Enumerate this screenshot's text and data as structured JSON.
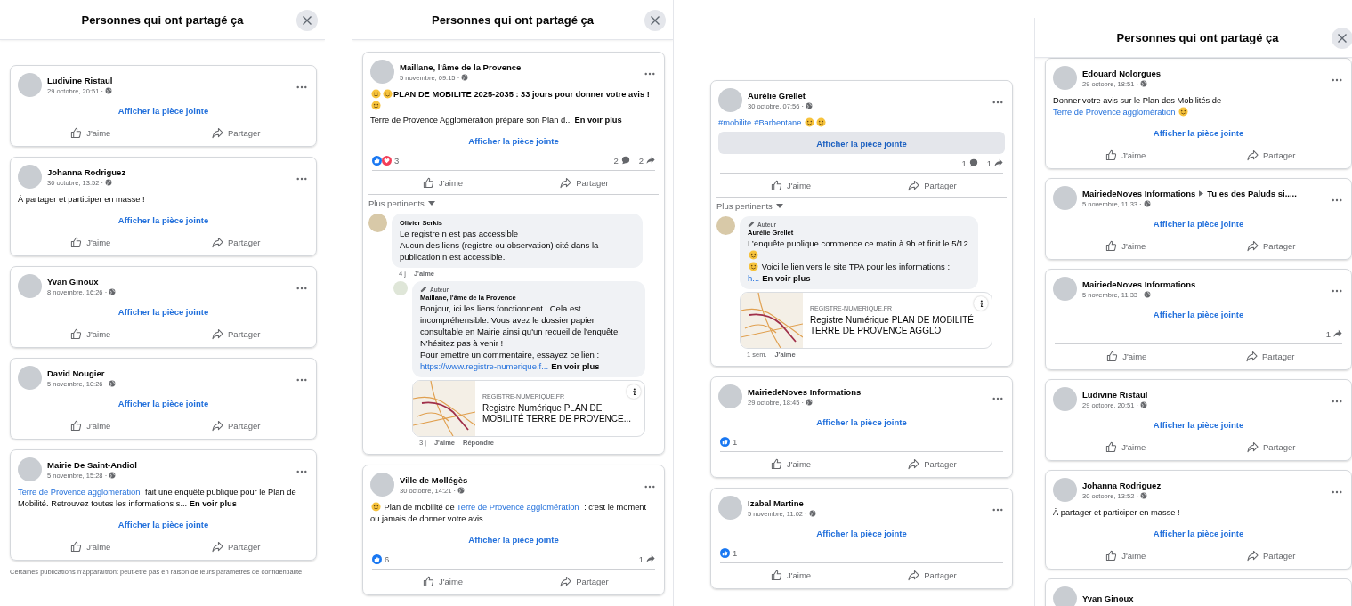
{
  "panels": [
    {
      "title": "Personnes qui ont partagé ça",
      "posts": [
        {
          "author": "Ludivine Ristaul",
          "date": "29 octobre, 20:51 ·",
          "attachment": {
            "label": "Afficher la pièce jointe",
            "highlighted": false
          },
          "actions": [
            {
              "kind": "like",
              "label": "J'aime"
            },
            {
              "kind": "share",
              "label": "Partager"
            }
          ]
        },
        {
          "author": "Johanna Rodriguez",
          "date": "30 octobre, 13:52 ·",
          "text": [
            [
              {
                "kind": "plain",
                "text": "À partager et participer en masse !"
              }
            ]
          ],
          "attachment": {
            "label": "Afficher la pièce jointe",
            "highlighted": false
          },
          "actions": [
            {
              "kind": "like",
              "label": "J'aime"
            },
            {
              "kind": "share",
              "label": "Partager"
            }
          ]
        },
        {
          "author": "Yvan Ginoux",
          "date": "8 novembre, 16:26 ·",
          "attachment": {
            "label": "Afficher la pièce jointe",
            "highlighted": false
          },
          "actions": [
            {
              "kind": "like",
              "label": "J'aime"
            },
            {
              "kind": "share",
              "label": "Partager"
            }
          ]
        },
        {
          "author": "David Nougier",
          "date": "5 novembre, 10:26 ·",
          "attachment": {
            "label": "Afficher la pièce jointe",
            "highlighted": false
          },
          "actions": [
            {
              "kind": "like",
              "label": "J'aime"
            },
            {
              "kind": "share",
              "label": "Partager"
            }
          ]
        },
        {
          "author": "Mairie De Saint-Andiol",
          "date": "5 novembre, 15:28 ·",
          "text": [
            [
              {
                "kind": "link",
                "text": "Terre de Provence agglomération"
              },
              {
                "kind": "plain",
                "text": "  fait une enquête publique pour le Plan de Mobilité.  Retrouvez toutes les informations s... "
              },
              {
                "kind": "more",
                "text": "En voir plus"
              }
            ]
          ],
          "attachment": {
            "label": "Afficher la pièce jointe",
            "highlighted": false
          },
          "actions": [
            {
              "kind": "like",
              "label": "J'aime"
            },
            {
              "kind": "share",
              "label": "Partager"
            }
          ]
        }
      ],
      "footer": "Certaines publications n'apparaîtront peut-être pas en raison de leurs paramètres de confidentialité"
    },
    {
      "title": "Personnes qui ont partagé ça",
      "posts": [
        {
          "author": "Maillane, l'âme de la Provence",
          "date": "5 novembre, 09:15 ·",
          "text": [
            [
              {
                "kind": "emoji"
              },
              {
                "kind": "emoji"
              },
              {
                "kind": "bold",
                "text": "PLAN DE MOBILITE 2025-2035 : 33 jours pour donner votre avis !"
              },
              {
                "kind": "emoji"
              }
            ],
            [
              {
                "kind": "plain",
                "text": "Terre de Provence Agglomération prépare son Plan d... "
              },
              {
                "kind": "more",
                "text": "En voir plus"
              }
            ]
          ],
          "attachment": {
            "label": "Afficher la pièce jointe",
            "highlighted": false
          },
          "reactions": {
            "icons": [
              {
                "kind": "like"
              },
              {
                "kind": "love"
              }
            ],
            "count": "3",
            "comments": "2",
            "shares": "2"
          },
          "actions": [
            {
              "kind": "like",
              "label": "J'aime"
            },
            {
              "kind": "share",
              "label": "Partager"
            }
          ],
          "comments": {
            "sort_label": "Plus pertinents",
            "items": [
              {
                "author": "Olivier Serkis",
                "text": [
                  [
                    {
                      "kind": "plain",
                      "text": "Le registre n est pas accessible"
                    }
                  ],
                  [
                    {
                      "kind": "plain",
                      "text": "Aucun des liens (registre ou observation) cité dans la publication n est accessible."
                    }
                  ]
                ],
                "meta": [
                  {
                    "kind": "time",
                    "label": "4 j"
                  },
                  {
                    "kind": "action",
                    "label": "J'aime"
                  }
                ],
                "replies": [
                  {
                    "badge": "Auteur",
                    "author": "Maillane, l'âme de la Provence",
                    "text": [
                      [
                        {
                          "kind": "plain",
                          "text": "Bonjour, ici les liens fonctionnent.. Cela est incompréhensible. Vous avez le dossier papier consultable en Mairie ainsi qu'un recueil de l'enquête."
                        }
                      ],
                      [
                        {
                          "kind": "plain",
                          "text": "N'hésitez pas à venir !"
                        }
                      ],
                      [
                        {
                          "kind": "plain",
                          "text": "Pour emettre un commentaire, essayez ce lien :"
                        }
                      ],
                      [
                        {
                          "kind": "link",
                          "text": "https://www.registre-numerique.f..."
                        },
                        {
                          "kind": "more",
                          "text": "En voir plus"
                        }
                      ]
                    ],
                    "preview": {
                      "domain": "REGISTRE-NUMERIQUE.FR",
                      "title": "Registre Numérique PLAN DE MOBILITÉ TERRE DE PROVENCE..."
                    },
                    "meta": [
                      {
                        "kind": "time",
                        "label": "3 j"
                      },
                      {
                        "kind": "action",
                        "label": "J'aime"
                      },
                      {
                        "kind": "action",
                        "label": "Répondre"
                      }
                    ]
                  }
                ]
              }
            ]
          }
        },
        {
          "author": "Ville de Mollégès",
          "date": "30 octobre, 14:21 ·",
          "text": [
            [
              {
                "kind": "emoji"
              },
              {
                "kind": "plain",
                "text": " Plan de mobilité de "
              },
              {
                "kind": "link",
                "text": "Terre de Provence agglomération"
              },
              {
                "kind": "plain",
                "text": " : c'est le moment ou jamais de donner votre avis"
              }
            ]
          ],
          "attachment": {
            "label": "Afficher la pièce jointe",
            "highlighted": false
          },
          "reactions": {
            "icons": [
              {
                "kind": "like"
              }
            ],
            "count": "6",
            "shares": "1"
          },
          "actions": [
            {
              "kind": "like",
              "label": "J'aime"
            },
            {
              "kind": "share",
              "label": "Partager"
            }
          ]
        }
      ]
    },
    {
      "posts": [
        {
          "author": "Aurélie Grellet",
          "date": "30 octobre, 07:56 ·",
          "text": [
            [
              {
                "kind": "link",
                "text": "#mobilite"
              },
              {
                "kind": "link",
                "text": "#Barbentane"
              },
              {
                "kind": "emoji"
              },
              {
                "kind": "emoji"
              }
            ]
          ],
          "attachment": {
            "label": "Afficher la pièce jointe",
            "highlighted": true
          },
          "reactions": {
            "comments": "1",
            "shares": "1"
          },
          "actions": [
            {
              "kind": "like",
              "label": "J'aime"
            },
            {
              "kind": "share",
              "label": "Partager"
            }
          ],
          "comments": {
            "sort_label": "Plus pertinents",
            "items": [
              {
                "badge": "Auteur",
                "author": "Aurélie Grellet",
                "text": [
                  [
                    {
                      "kind": "plain",
                      "text": "L’enquête publique commence ce matin à 9h et finit le 5/12."
                    }
                  ],
                  [
                    {
                      "kind": "emoji"
                    }
                  ],
                  [
                    {
                      "kind": "emoji"
                    },
                    {
                      "kind": "plain",
                      "text": " Voici le lien vers le site TPA pour les informations :"
                    }
                  ],
                  [
                    {
                      "kind": "link",
                      "text": "h..."
                    },
                    {
                      "kind": "more",
                      "text": "En voir plus"
                    }
                  ]
                ],
                "preview": {
                  "domain": "REGISTRE-NUMERIQUE.FR",
                  "title": "Registre Numérique PLAN DE MOBILITÉ TERRE DE PROVENCE AGGLO"
                },
                "meta": [
                  {
                    "kind": "time",
                    "label": "1 sem."
                  },
                  {
                    "kind": "action",
                    "label": "J'aime"
                  }
                ]
              }
            ]
          }
        },
        {
          "author": "MairiedeNoves Informations",
          "date": "29 octobre, 18:45 ·",
          "attachment": {
            "label": "Afficher la pièce jointe",
            "highlighted": false
          },
          "reactions": {
            "icons": [
              {
                "kind": "like"
              }
            ],
            "count": "1"
          },
          "actions": [
            {
              "kind": "like",
              "label": "J'aime"
            },
            {
              "kind": "share",
              "label": "Partager"
            }
          ]
        },
        {
          "author": "Izabal Martine",
          "date": "5 novembre, 11:02 ·",
          "attachment": {
            "label": "Afficher la pièce jointe",
            "highlighted": false
          },
          "reactions": {
            "icons": [
              {
                "kind": "like"
              }
            ],
            "count": "1"
          },
          "actions": [
            {
              "kind": "like",
              "label": "J'aime"
            },
            {
              "kind": "share",
              "label": "Partager"
            }
          ]
        }
      ]
    },
    {
      "title": "Personnes qui ont partagé ça",
      "posts": [
        {
          "author": "Edouard Nolorgues",
          "date": "29 octobre, 18:51 ·",
          "text": [
            [
              {
                "kind": "plain",
                "text": "Donner votre avis sur le Plan des Mobilités de "
              },
              {
                "kind": "link",
                "text": "Terre de Provence agglomération"
              },
              {
                "kind": "emoji"
              }
            ]
          ],
          "attachment": {
            "label": "Afficher la pièce jointe",
            "highlighted": false
          },
          "actions": [
            {
              "kind": "like",
              "label": "J'aime"
            },
            {
              "kind": "share",
              "label": "Partager"
            }
          ]
        },
        {
          "author": "MairiedeNoves Informations",
          "group": "Tu es des Paluds si.....",
          "date": "5 novembre, 11:33 ·",
          "attachment": {
            "label": "Afficher la pièce jointe",
            "highlighted": false
          },
          "actions": [
            {
              "kind": "like",
              "label": "J'aime"
            },
            {
              "kind": "share",
              "label": "Partager"
            }
          ]
        },
        {
          "author": "MairiedeNoves Informations",
          "date": "5 novembre, 11:33 ·",
          "attachment": {
            "label": "Afficher la pièce jointe",
            "highlighted": false
          },
          "reactions": {
            "shares": "1"
          },
          "actions": [
            {
              "kind": "like",
              "label": "J'aime"
            },
            {
              "kind": "share",
              "label": "Partager"
            }
          ]
        },
        {
          "author": "Ludivine Ristaul",
          "date": "29 octobre, 20:51 ·",
          "attachment": {
            "label": "Afficher la pièce jointe",
            "highlighted": false
          },
          "actions": [
            {
              "kind": "like",
              "label": "J'aime"
            },
            {
              "kind": "share",
              "label": "Partager"
            }
          ]
        },
        {
          "author": "Johanna Rodriguez",
          "date": "30 octobre, 13:52 ·",
          "text": [
            [
              {
                "kind": "plain",
                "text": "À partager et participer en masse !"
              }
            ]
          ],
          "attachment": {
            "label": "Afficher la pièce jointe",
            "highlighted": false
          },
          "actions": [
            {
              "kind": "like",
              "label": "J'aime"
            },
            {
              "kind": "share",
              "label": "Partager"
            }
          ]
        },
        {
          "author": "Yvan Ginoux"
        }
      ]
    }
  ]
}
